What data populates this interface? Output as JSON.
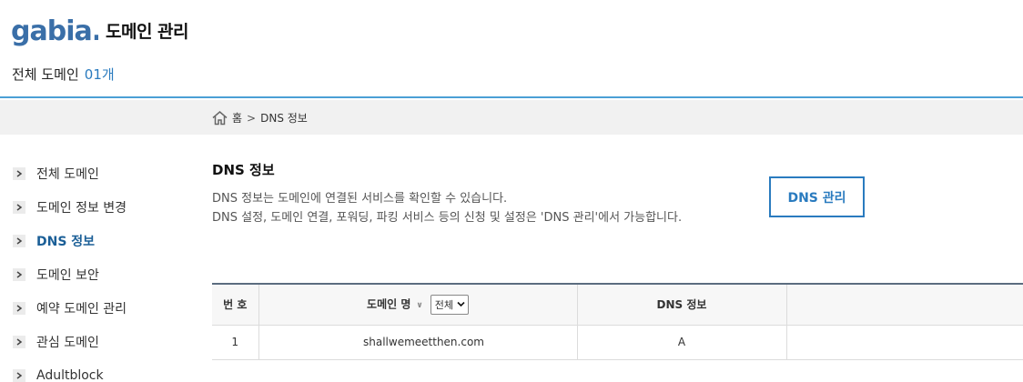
{
  "header": {
    "logo_text": "gabia.",
    "title": "도메인 관리",
    "domain_count_label": "전체 도메인",
    "domain_count_value": "01개",
    "accent_color": "#4a9fd5"
  },
  "breadcrumb": {
    "icon": "home-icon",
    "home_label": "홈",
    "separator": ">",
    "current": "DNS 정보"
  },
  "sidebar": {
    "items": [
      {
        "label": "전체 도메인",
        "active": false
      },
      {
        "label": "도메인 정보 변경",
        "active": false
      },
      {
        "label": "DNS 정보",
        "active": true
      },
      {
        "label": "도메인 보안",
        "active": false
      },
      {
        "label": "예약 도메인 관리",
        "active": false
      },
      {
        "label": "관심 도메인",
        "active": false
      },
      {
        "label": "Adultblock",
        "active": false
      }
    ]
  },
  "main": {
    "title": "DNS 정보",
    "desc_line1": "DNS 정보는 도메인에 연결된 서비스를 확인할 수 있습니다.",
    "desc_line2": "DNS 설정, 도메인 연결, 포워딩, 파킹 서비스 등의 신청 및 설정은 'DNS 관리'에서 가능합니다.",
    "dns_button": "DNS 관리",
    "button_color": "#2a7bbf"
  },
  "table": {
    "headers": {
      "number": "번 호",
      "domain": "도메인 명",
      "sort_icon": "chevron-down-icon",
      "dns": "DNS 정보",
      "extra": ""
    },
    "filter": {
      "selected": "전체"
    },
    "rows": [
      {
        "number": "1",
        "domain": "shallwemeetthen.com",
        "dns": "A",
        "extra": ""
      }
    ]
  }
}
